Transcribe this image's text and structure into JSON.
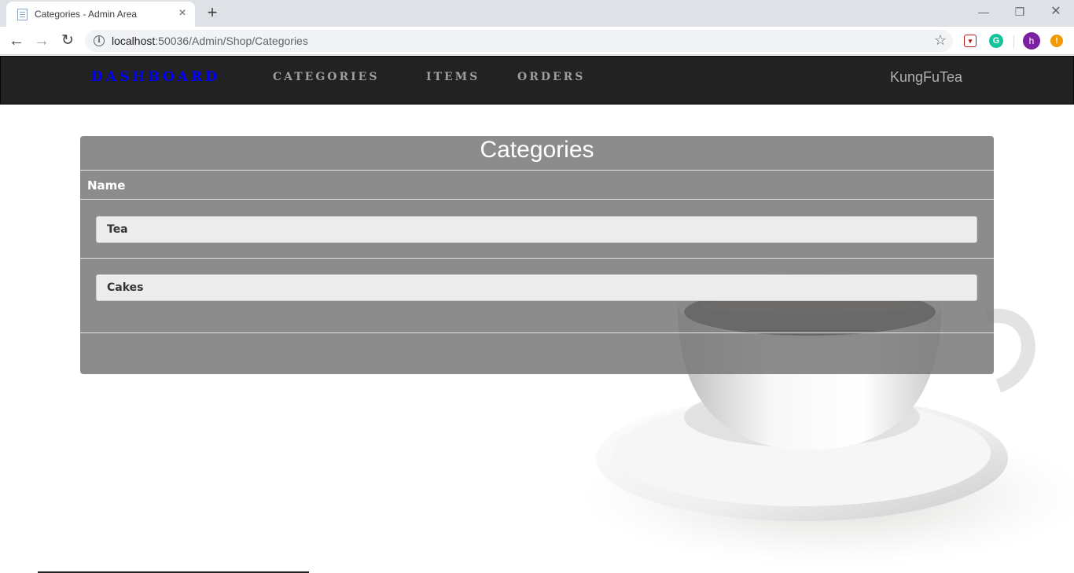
{
  "browser": {
    "tab_title": "Categories - Admin Area",
    "url_host": "localhost",
    "url_rest": ":50036/Admin/Shop/Categories",
    "profile_initial": "h"
  },
  "navbar": {
    "links": [
      "Dashboard",
      "Categories",
      "Items",
      "Orders"
    ],
    "brand": "KungFuTea",
    "active_color": "#0000ff"
  },
  "panel": {
    "title": "Categories",
    "column_header": "Name",
    "rows": [
      "Tea",
      "Cakes"
    ]
  }
}
